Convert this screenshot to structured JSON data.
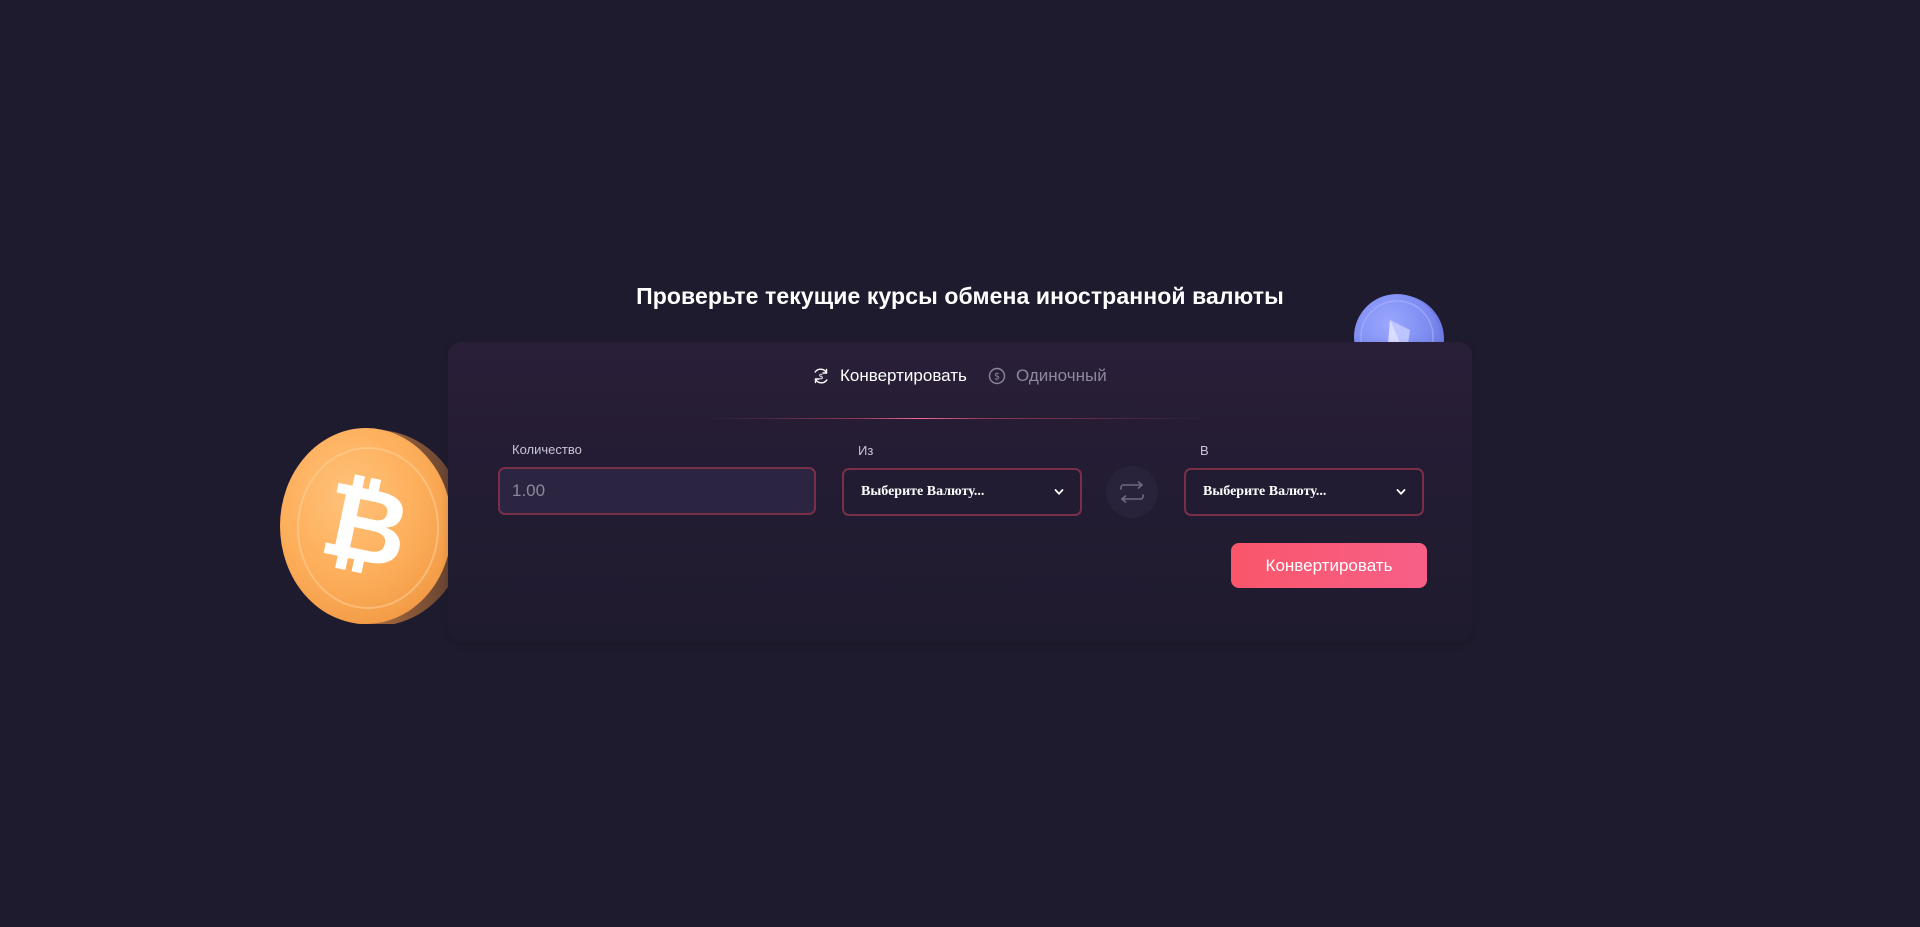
{
  "heading": "Проверьте текущие курсы обмена иностранной валюты",
  "tabs": [
    {
      "label": "Конвертировать",
      "icon": "convert-cycle-icon",
      "active": true
    },
    {
      "label": "Одиночный",
      "icon": "dollar-circle-icon",
      "active": false
    }
  ],
  "form": {
    "quantity_label": "Количество",
    "quantity_placeholder": "1.00",
    "from_label": "Из",
    "from_value": "Выберите Валюту...",
    "to_label": "В",
    "to_value": "Выберите Валюту...",
    "submit_label": "Конвертировать"
  },
  "decor": {
    "left_coin": "bitcoin-coin-icon",
    "right_coin": "ethereum-coin-icon"
  },
  "colors": {
    "background": "#1f1b2e",
    "accent": "#f9566a",
    "field_border": "#7a2f49"
  }
}
